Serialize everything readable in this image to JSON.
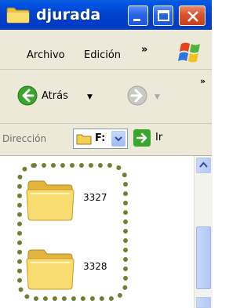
{
  "window": {
    "title": "djurada",
    "title_icon": "folder-icon",
    "title_buttons": [
      "minimize-icon",
      "maximize-icon",
      "close-icon"
    ]
  },
  "menu": {
    "items": [
      {
        "label": "Archivo"
      },
      {
        "label": "Edición"
      }
    ],
    "overflow": "»",
    "logo_icon": "windows-logo-icon"
  },
  "toolbar": {
    "back_label": "Atrás",
    "back_icon": "back-arrow-icon",
    "forward_icon": "forward-arrow-icon",
    "overflow": "»"
  },
  "address": {
    "label": "Dirección",
    "value": "F:",
    "go_label": "Ir",
    "go_icon": "go-arrow-icon"
  },
  "files": [
    {
      "name": "3327",
      "icon": "folder-icon"
    },
    {
      "name": "3328",
      "icon": "folder-icon"
    }
  ],
  "colors": {
    "titlebar": "#0041cc",
    "chrome": "#ece9d8",
    "selection_ring": "#6f7f36"
  }
}
